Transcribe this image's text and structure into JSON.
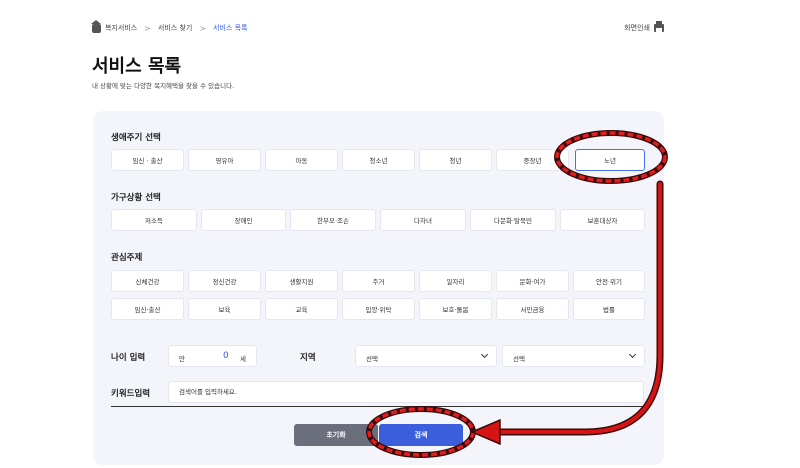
{
  "breadcrumb": {
    "items": [
      "복지서비스",
      "서비스 찾기",
      "서비스 목록"
    ],
    "print_label": "화면인쇄"
  },
  "header": {
    "title": "서비스 목록",
    "description": "내 상황에 맞는 다양한 복지혜택을 찾을 수 있습니다."
  },
  "life_cycle": {
    "title": "생애주기 선택",
    "items": [
      "임신 · 출산",
      "영유아",
      "아동",
      "청소년",
      "청년",
      "중장년",
      "노년"
    ],
    "selected": "노년"
  },
  "household": {
    "title": "가구상황 선택",
    "items": [
      "저소득",
      "장애인",
      "한부모·조손",
      "다자녀",
      "다문화·탈북민",
      "보훈대상자"
    ]
  },
  "interest": {
    "title": "관심주제",
    "row1": [
      "신체건강",
      "정신건강",
      "생활지원",
      "주거",
      "일자리",
      "문화·여가",
      "안전·위기"
    ],
    "row2": [
      "임신·출산",
      "보육",
      "교육",
      "입양·위탁",
      "보호·돌봄",
      "서민금융",
      "법률"
    ]
  },
  "age": {
    "label": "나이 입력",
    "prefix": "만",
    "value": "0",
    "suffix": "세"
  },
  "region": {
    "label": "지역",
    "select1": "선택",
    "select2": "선택"
  },
  "keyword": {
    "label": "키워드입력",
    "placeholder": "검색어를 입력하세요."
  },
  "buttons": {
    "reset": "초기화",
    "search": "검색"
  },
  "annotation_colors": {
    "ring_red": "#e11d1d",
    "ring_dark": "#3a0a0a",
    "arrow_red": "#d61414"
  }
}
